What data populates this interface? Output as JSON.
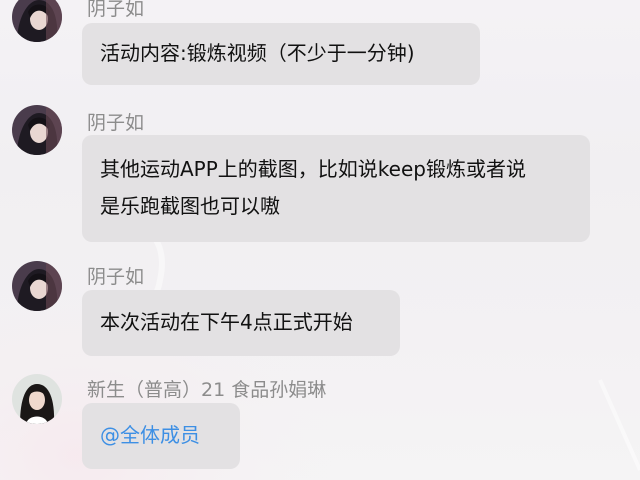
{
  "messages": [
    {
      "sender": "阴子如",
      "avatar": "avatar-anime-dark",
      "lines": [
        "活动内容:锻炼视频（不少于一分钟)"
      ]
    },
    {
      "sender": "阴子如",
      "avatar": "avatar-anime-dark",
      "lines": [
        "其他运动APP上的截图，比如说keep锻炼或者说",
        "是乐跑截图也可以嗷"
      ]
    },
    {
      "sender": "阴子如",
      "avatar": "avatar-anime-dark",
      "lines": [
        "本次活动在下午4点正式开始"
      ]
    },
    {
      "sender": "新生（普高）21 食品孙娟琳",
      "avatar": "avatar-photo-girl",
      "lines": [
        "@全体成员"
      ]
    }
  ],
  "colors": {
    "bubble": "#e3e1e3",
    "sender": "#8c8c8c",
    "mention": "#3d8fe4",
    "text": "#111111"
  }
}
